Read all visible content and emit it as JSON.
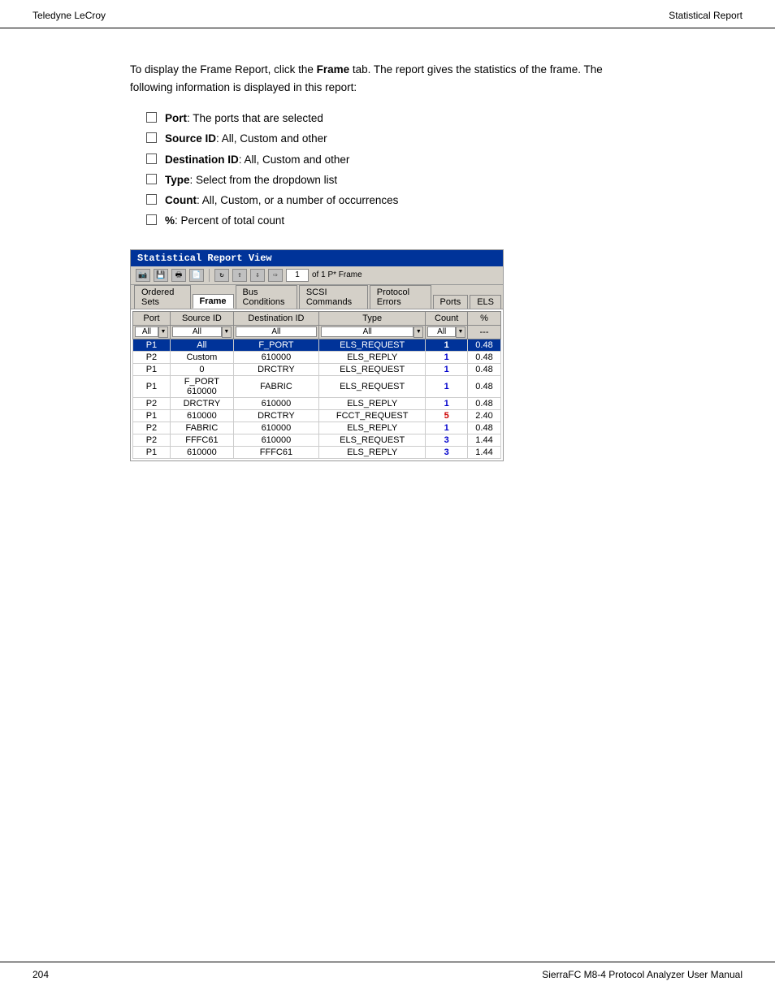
{
  "header": {
    "left": "Teledyne LeCroy",
    "right": "Statistical Report"
  },
  "footer": {
    "left": "204",
    "right": "SierraFC M8-4 Protocol Analyzer User Manual"
  },
  "content": {
    "intro": "To display the Frame Report, click the Frame tab. The report gives the statistics of the frame. The following information is displayed in this report:",
    "bullets": [
      {
        "label": "Port",
        "text": ": The ports that are selected"
      },
      {
        "label": "Source ID",
        "text": ": All, Custom and other"
      },
      {
        "label": "Destination ID",
        "text": ": All, Custom and other"
      },
      {
        "label": "Type",
        "text": ": Select from the dropdown list"
      },
      {
        "label": "Count",
        "text": ": All, Custom, or a number of occurrences"
      },
      {
        "label": "%",
        "text": ": Percent of total count"
      }
    ]
  },
  "screenshot": {
    "title": "Statistical Report View",
    "toolbar": {
      "nav_value": "1",
      "nav_label": "of 1  P*  Frame"
    },
    "tabs": [
      {
        "label": "Ordered Sets",
        "active": false
      },
      {
        "label": "Frame",
        "active": true
      },
      {
        "label": "Bus Conditions",
        "active": false
      },
      {
        "label": "SCSI Commands",
        "active": false
      },
      {
        "label": "Protocol Errors",
        "active": false
      },
      {
        "label": "Ports",
        "active": false
      },
      {
        "label": "ELS",
        "active": false
      }
    ],
    "table": {
      "headers": [
        "Port",
        "Source ID",
        "Destination ID",
        "Type",
        "Count",
        "%"
      ],
      "filters": [
        "All",
        "All",
        "All",
        "All",
        "All",
        "---"
      ],
      "rows": [
        {
          "port": "P1",
          "source": "All",
          "dest": "F_PORT",
          "type": "ELS_REQUEST",
          "count": "1",
          "pct": "0.48",
          "selected": true,
          "count_color": "blue"
        },
        {
          "port": "P2",
          "source": "Custom",
          "dest": "610000",
          "type": "ELS_REPLY",
          "count": "1",
          "pct": "0.48",
          "selected": false,
          "count_color": "blue"
        },
        {
          "port": "P1",
          "source": "0",
          "dest": "DRCTRY",
          "type": "ELS_REQUEST",
          "count": "1",
          "pct": "0.48",
          "selected": false,
          "count_color": "blue"
        },
        {
          "port": "P1",
          "source": "F_PORT\n610000",
          "dest": "FABRIC",
          "type": "ELS_REQUEST",
          "count": "1",
          "pct": "0.48",
          "selected": false,
          "count_color": "blue"
        },
        {
          "port": "P2",
          "source": "DRCTRY",
          "dest": "610000",
          "type": "ELS_REPLY",
          "count": "1",
          "pct": "0.48",
          "selected": false,
          "count_color": "blue"
        },
        {
          "port": "P1",
          "source": "610000",
          "dest": "DRCTRY",
          "type": "FCCT_REQUEST",
          "count": "5",
          "pct": "2.40",
          "selected": false,
          "count_color": "red"
        },
        {
          "port": "P2",
          "source": "FABRIC",
          "dest": "610000",
          "type": "ELS_REPLY",
          "count": "1",
          "pct": "0.48",
          "selected": false,
          "count_color": "blue"
        },
        {
          "port": "P2",
          "source": "FFFC61",
          "dest": "610000",
          "type": "ELS_REQUEST",
          "count": "3",
          "pct": "1.44",
          "selected": false,
          "count_color": "blue"
        },
        {
          "port": "P1",
          "source": "610000",
          "dest": "FFFC61",
          "type": "ELS_REPLY",
          "count": "3",
          "pct": "1.44",
          "selected": false,
          "count_color": "blue"
        }
      ]
    }
  }
}
